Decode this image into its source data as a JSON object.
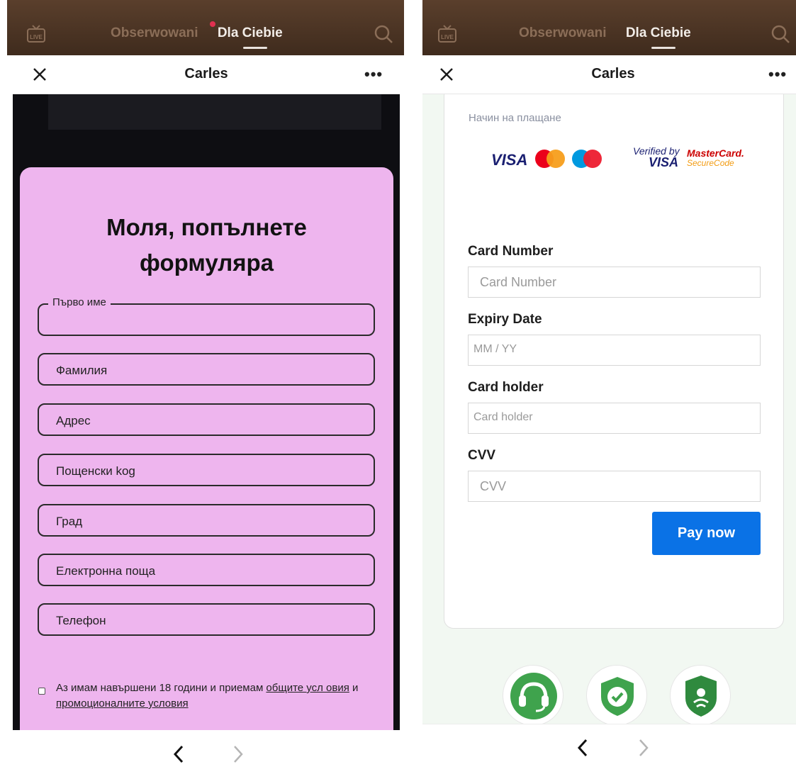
{
  "left": {
    "topbar": {
      "following": "Obserwowani",
      "for_you": "Dla Ciebie",
      "live_badge": "LIVE"
    },
    "header": {
      "title": "Carles"
    },
    "form": {
      "title_line1": "Моля, попълнете",
      "title_line2": "формуляра",
      "first_name_legend": "Първо име",
      "last_name": "Фамилия",
      "address": "Адрес",
      "postal_code": "Пощенски kog",
      "city": "Град",
      "email": "Електронна поща",
      "phone": "Телефон",
      "consent_prefix": "Аз имам навършени 18 години и приемам ",
      "consent_terms_link": "общите усл овия",
      "consent_and": " и ",
      "consent_promo_link": "промоционалните условия"
    }
  },
  "right": {
    "topbar": {
      "following": "Obserwowani",
      "for_you": "Dla Ciebie",
      "live_badge": "LIVE"
    },
    "header": {
      "title": "Carles"
    },
    "payment": {
      "method_label": "Начин на плащане",
      "logos": {
        "visa": "VISA",
        "verified_a": "Verified by",
        "verified_b": "VISA",
        "securecode_a": "MasterCard.",
        "securecode_b": "SecureCode"
      },
      "card_number_label": "Card Number",
      "card_number_placeholder": "Card Number",
      "expiry_label": "Expiry Date",
      "expiry_placeholder": "MM / YY",
      "holder_label": "Card holder",
      "holder_placeholder": "Card holder",
      "cvv_label": "CVV",
      "cvv_placeholder": "CVV",
      "pay_button": "Pay now"
    }
  },
  "colors": {
    "form_bg": "#eeb5ee",
    "pay_button": "#0a72e6",
    "badge_green": "#3fa34d",
    "topbar": "#4a3424"
  },
  "icons": [
    "live-icon",
    "search-icon",
    "close-icon",
    "more-icon",
    "back-chevron-icon",
    "forward-chevron-icon",
    "support-headset-icon",
    "shield-check-icon",
    "secure-lock-icon"
  ]
}
